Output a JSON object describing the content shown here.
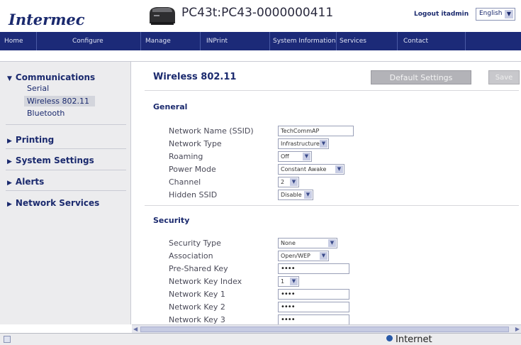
{
  "header": {
    "logo": "Intermec",
    "device_title": "PC43t:PC43-0000000411",
    "logout": "Logout itadmin",
    "language": "English"
  },
  "nav": {
    "items": [
      "Home",
      "Configure",
      "Manage",
      "INPrint",
      "System Information",
      "Services",
      "Contact"
    ]
  },
  "sidebar": {
    "communications": "Communications",
    "comm_items": [
      "Serial",
      "Wireless 802.11",
      "Bluetooth"
    ],
    "printing": "Printing",
    "system_settings": "System Settings",
    "alerts": "Alerts",
    "network_services": "Network Services"
  },
  "main": {
    "title": "Wireless 802.11",
    "default_settings": "Default Settings",
    "save": "Save",
    "general_title": "General",
    "general_fields": {
      "ssid_label": "Network Name (SSID)",
      "ssid_value": "TechCommAP",
      "network_type_label": "Network Type",
      "network_type_value": "Infrastructure",
      "roaming_label": "Roaming",
      "roaming_value": "Off",
      "power_mode_label": "Power Mode",
      "power_mode_value": "Constant Awake",
      "channel_label": "Channel",
      "channel_value": "2",
      "hidden_ssid_label": "Hidden SSID",
      "hidden_ssid_value": "Disable"
    },
    "security_title": "Security",
    "security_fields": {
      "security_type_label": "Security Type",
      "security_type_value": "None",
      "association_label": "Association",
      "association_value": "Open/WEP",
      "psk_label": "Pre-Shared Key",
      "psk_value": "••••",
      "key_index_label": "Network Key Index",
      "key_index_value": "1",
      "key1_label": "Network Key 1",
      "key1_value": "••••",
      "key2_label": "Network Key 2",
      "key2_value": "••••",
      "key3_label": "Network Key 3",
      "key3_value": "••••"
    }
  },
  "status": {
    "zone": "Internet"
  },
  "colors": {
    "nav_bg": "#1c2a78",
    "brand": "#1b2a6e",
    "sidebar_bg": "#ececee"
  }
}
